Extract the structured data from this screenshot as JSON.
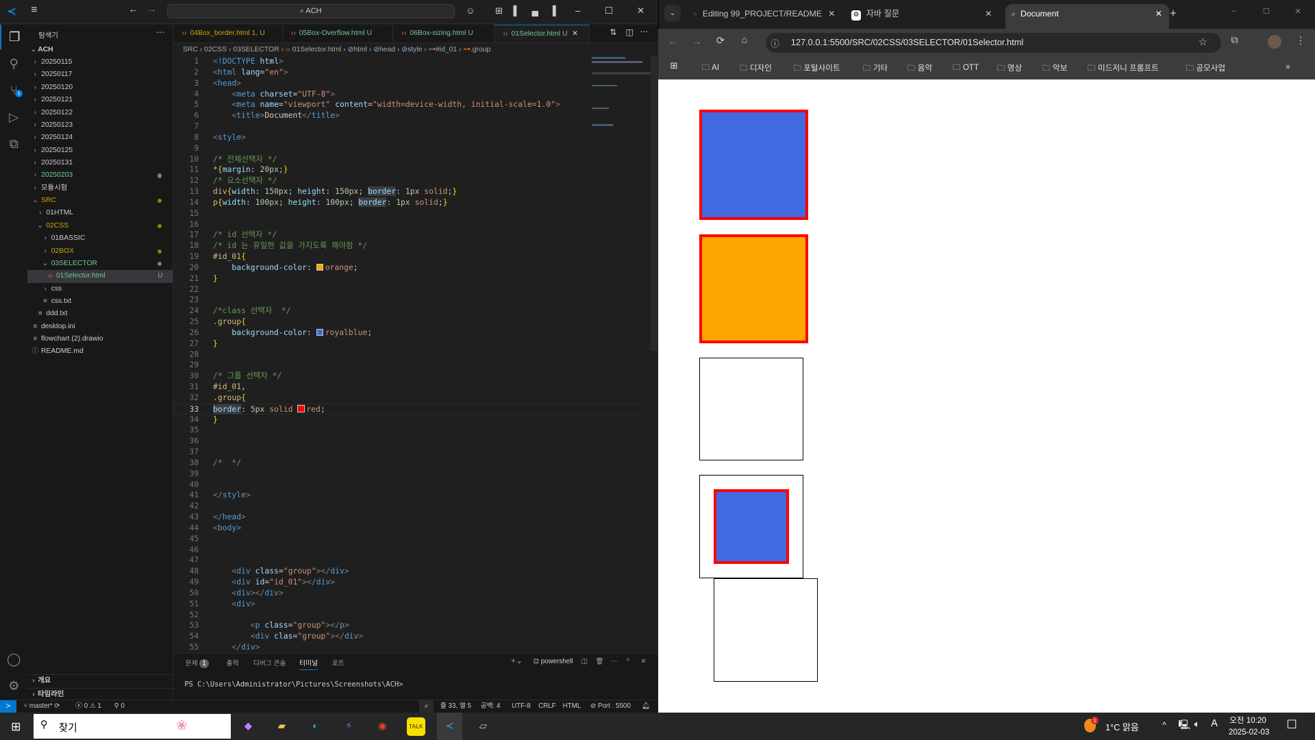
{
  "vscode": {
    "search": "ACH",
    "explorer_title": "탐색기",
    "root": "ACH",
    "tree": [
      {
        "label": "20250115",
        "depth": 0,
        "kind": "folder",
        "open": false,
        "color": "#cccccc"
      },
      {
        "label": "20250117",
        "depth": 0,
        "kind": "folder",
        "open": false,
        "color": "#cccccc"
      },
      {
        "label": "20250120",
        "depth": 0,
        "kind": "folder",
        "open": false,
        "color": "#cccccc"
      },
      {
        "label": "20250121",
        "depth": 0,
        "kind": "folder",
        "open": false,
        "color": "#cccccc"
      },
      {
        "label": "20250122",
        "depth": 0,
        "kind": "folder",
        "open": false,
        "color": "#cccccc"
      },
      {
        "label": "20250123",
        "depth": 0,
        "kind": "folder",
        "open": false,
        "color": "#cccccc"
      },
      {
        "label": "20250124",
        "depth": 0,
        "kind": "folder",
        "open": false,
        "color": "#cccccc"
      },
      {
        "label": "20250125",
        "depth": 0,
        "kind": "folder",
        "open": false,
        "color": "#cccccc"
      },
      {
        "label": "20250131",
        "depth": 0,
        "kind": "folder",
        "open": false,
        "color": "#cccccc"
      },
      {
        "label": "20250203",
        "depth": 0,
        "kind": "folder",
        "open": false,
        "color": "#73c991",
        "dot": true
      },
      {
        "label": "모듈시험",
        "depth": 0,
        "kind": "folder",
        "open": false,
        "color": "#cccccc"
      },
      {
        "label": "SRC",
        "depth": 0,
        "kind": "folder",
        "open": true,
        "color": "#cca700",
        "dot": true
      },
      {
        "label": "01HTML",
        "depth": 1,
        "kind": "folder",
        "open": false,
        "color": "#cccccc"
      },
      {
        "label": "02CSS",
        "depth": 1,
        "kind": "folder",
        "open": true,
        "color": "#cca700",
        "dot": true
      },
      {
        "label": "01BASSIC",
        "depth": 2,
        "kind": "folder",
        "open": false,
        "color": "#cccccc"
      },
      {
        "label": "02BOX",
        "depth": 2,
        "kind": "folder",
        "open": false,
        "color": "#cca700",
        "dot": true
      },
      {
        "label": "03SELECTOR",
        "depth": 2,
        "kind": "folder",
        "open": true,
        "color": "#73c991",
        "dot": true
      },
      {
        "label": "01Selector.html",
        "depth": 3,
        "kind": "html",
        "color": "#73c991",
        "badge": "U",
        "selected": true
      },
      {
        "label": "css",
        "depth": 2,
        "kind": "folder",
        "open": false,
        "color": "#cccccc"
      },
      {
        "label": "css.txt",
        "depth": 2,
        "kind": "file",
        "color": "#cccccc"
      },
      {
        "label": "ddd.txt",
        "depth": 1,
        "kind": "file",
        "color": "#cccccc"
      },
      {
        "label": "desktop.ini",
        "depth": 0,
        "kind": "file",
        "color": "#cccccc"
      },
      {
        "label": "flowchart (2).drawio",
        "depth": 0,
        "kind": "file",
        "color": "#cccccc"
      },
      {
        "label": "README.md",
        "depth": 0,
        "kind": "info",
        "color": "#cccccc"
      }
    ],
    "outline": "개요",
    "timeline": "타임라인",
    "tabs": [
      {
        "label": "04Box_border.html",
        "status": "1, U",
        "color": "#cca700"
      },
      {
        "label": "05Box-Overflow.html",
        "status": "U",
        "color": "#73c991"
      },
      {
        "label": "06Box-sizing.html",
        "status": "U",
        "color": "#73c991"
      },
      {
        "label": "01Selector.html",
        "status": "U",
        "color": "#73c991",
        "active": true
      }
    ],
    "breadcrumb": [
      "SRC",
      "02CSS",
      "03SELECTOR",
      "01Selector.html",
      "html",
      "head",
      "style",
      "#id_01",
      ".group"
    ],
    "code": [
      [
        [
          "<",
          "br"
        ],
        [
          "!DOCTYPE",
          "tag"
        ],
        [
          " html",
          "attr"
        ],
        [
          ">",
          "br"
        ]
      ],
      [
        [
          "<",
          "br"
        ],
        [
          "html",
          "tag"
        ],
        [
          " lang",
          "attr"
        ],
        [
          "=",
          "pun"
        ],
        [
          "\"en\"",
          "str"
        ],
        [
          ">",
          "br"
        ]
      ],
      [
        [
          "<",
          "br"
        ],
        [
          "head",
          "tag"
        ],
        [
          ">",
          "br"
        ]
      ],
      [
        [
          "    <",
          "br"
        ],
        [
          "meta",
          "tag"
        ],
        [
          " charset",
          "attr"
        ],
        [
          "=",
          "pun"
        ],
        [
          "\"UTF-8\"",
          "str"
        ],
        [
          ">",
          "br"
        ]
      ],
      [
        [
          "    <",
          "br"
        ],
        [
          "meta",
          "tag"
        ],
        [
          " name",
          "attr"
        ],
        [
          "=",
          "pun"
        ],
        [
          "\"viewport\"",
          "str"
        ],
        [
          " content",
          "attr"
        ],
        [
          "=",
          "pun"
        ],
        [
          "\"width=device-width, initial-scale=1.0\"",
          "str"
        ],
        [
          ">",
          "br"
        ]
      ],
      [
        [
          "    <",
          "br"
        ],
        [
          "title",
          "tag"
        ],
        [
          ">",
          "br"
        ],
        [
          "Document",
          "txt"
        ],
        [
          "</",
          "br"
        ],
        [
          "title",
          "tag"
        ],
        [
          ">",
          "br"
        ]
      ],
      [],
      [
        [
          "<",
          "br"
        ],
        [
          "style",
          "tag"
        ],
        [
          ">",
          "br"
        ]
      ],
      [],
      [
        [
          "/* 전체선택자 */",
          "com"
        ]
      ],
      [
        [
          "*",
          "sel"
        ],
        [
          "{",
          "brace"
        ],
        [
          "margin",
          "prop"
        ],
        [
          ": ",
          "pun"
        ],
        [
          "20px",
          "num"
        ],
        [
          ";",
          "pun"
        ],
        [
          "}",
          "brace"
        ]
      ],
      [
        [
          "/* 요소선택자 */",
          "com"
        ]
      ],
      [
        [
          "div",
          "sel"
        ],
        [
          "{",
          "brace"
        ],
        [
          "width",
          "prop"
        ],
        [
          ": ",
          "pun"
        ],
        [
          "150px",
          "num"
        ],
        [
          "; ",
          "pun"
        ],
        [
          "height",
          "prop"
        ],
        [
          ": ",
          "pun"
        ],
        [
          "150px",
          "num"
        ],
        [
          "; ",
          "pun"
        ],
        [
          "border",
          "hl"
        ],
        [
          ": ",
          "pun"
        ],
        [
          "1px",
          "num"
        ],
        [
          " solid",
          "val"
        ],
        [
          ";",
          "pun"
        ],
        [
          "}",
          "brace"
        ]
      ],
      [
        [
          "p",
          "sel"
        ],
        [
          "{",
          "brace"
        ],
        [
          "width",
          "prop"
        ],
        [
          ": ",
          "pun"
        ],
        [
          "100px",
          "num"
        ],
        [
          "; ",
          "pun"
        ],
        [
          "height",
          "prop"
        ],
        [
          ": ",
          "pun"
        ],
        [
          "100px",
          "num"
        ],
        [
          "; ",
          "pun"
        ],
        [
          "border",
          "hl"
        ],
        [
          ": ",
          "pun"
        ],
        [
          "1px",
          "num"
        ],
        [
          " solid",
          "val"
        ],
        [
          ";",
          "pun"
        ],
        [
          "}",
          "brace"
        ]
      ],
      [],
      [],
      [
        [
          "/* id 선택자 */",
          "com"
        ]
      ],
      [
        [
          "/* id 는 유일한 값을 가지도록 해야함 */",
          "com"
        ]
      ],
      [
        [
          "#id_01",
          "sel"
        ],
        [
          "{",
          "brace"
        ]
      ],
      [
        [
          "    background-color",
          "prop"
        ],
        [
          ": ",
          "pun"
        ],
        [
          "#orange",
          "swatch"
        ],
        [
          "orange",
          "val"
        ],
        [
          ";",
          "pun"
        ]
      ],
      [
        [
          "}",
          "brace"
        ]
      ],
      [],
      [],
      [
        [
          "/*class 선택자  */",
          "com"
        ]
      ],
      [
        [
          ".group",
          "sel"
        ],
        [
          "{",
          "brace"
        ]
      ],
      [
        [
          "    background-color",
          "prop"
        ],
        [
          ": ",
          "pun"
        ],
        [
          "#royalblue",
          "swatch"
        ],
        [
          "royalblue",
          "val"
        ],
        [
          ";",
          "pun"
        ]
      ],
      [
        [
          "}",
          "brace"
        ]
      ],
      [],
      [],
      [
        [
          "/* 그룹 선택자 */",
          "com"
        ]
      ],
      [
        [
          "#id_01",
          "sel"
        ],
        [
          ",",
          "pun"
        ]
      ],
      [
        [
          ".group",
          "sel"
        ],
        [
          "{",
          "brace"
        ]
      ],
      [
        [
          "border",
          "hl"
        ],
        [
          ": ",
          "pun"
        ],
        [
          "5px",
          "num"
        ],
        [
          " solid ",
          "val"
        ],
        [
          "#red",
          "swatch"
        ],
        [
          "red",
          "val"
        ],
        [
          ";",
          "pun"
        ]
      ],
      [
        [
          "}",
          "brace"
        ]
      ],
      [],
      [],
      [],
      [
        [
          "/*  */",
          "com"
        ]
      ],
      [],
      [],
      [
        [
          "</",
          "br"
        ],
        [
          "style",
          "tag"
        ],
        [
          ">",
          "br"
        ]
      ],
      [],
      [
        [
          "</",
          "br"
        ],
        [
          "head",
          "tag"
        ],
        [
          ">",
          "br"
        ]
      ],
      [
        [
          "<",
          "br"
        ],
        [
          "body",
          "tag"
        ],
        [
          ">",
          "br"
        ]
      ],
      [],
      [],
      [],
      [
        [
          "    <",
          "br"
        ],
        [
          "div",
          "tag"
        ],
        [
          " class",
          "attr"
        ],
        [
          "=",
          "pun"
        ],
        [
          "\"group\"",
          "str"
        ],
        [
          "></",
          "br"
        ],
        [
          "div",
          "tag"
        ],
        [
          ">",
          "br"
        ]
      ],
      [
        [
          "    <",
          "br"
        ],
        [
          "div",
          "tag"
        ],
        [
          " id",
          "attr"
        ],
        [
          "=",
          "pun"
        ],
        [
          "\"id_01\"",
          "str"
        ],
        [
          "></",
          "br"
        ],
        [
          "div",
          "tag"
        ],
        [
          ">",
          "br"
        ]
      ],
      [
        [
          "    <",
          "br"
        ],
        [
          "div",
          "tag"
        ],
        [
          "></",
          "br"
        ],
        [
          "div",
          "tag"
        ],
        [
          ">",
          "br"
        ]
      ],
      [
        [
          "    <",
          "br"
        ],
        [
          "div",
          "tag"
        ],
        [
          ">",
          "br"
        ]
      ],
      [],
      [
        [
          "        <",
          "br"
        ],
        [
          "p",
          "tag"
        ],
        [
          " class",
          "attr"
        ],
        [
          "=",
          "pun"
        ],
        [
          "\"group\"",
          "str"
        ],
        [
          "></",
          "br"
        ],
        [
          "p",
          "tag"
        ],
        [
          ">",
          "br"
        ]
      ],
      [
        [
          "        <",
          "br"
        ],
        [
          "div",
          "tag"
        ],
        [
          " clas",
          "attr"
        ],
        [
          "=",
          "pun"
        ],
        [
          "\"group\"",
          "str"
        ],
        [
          "></",
          "br"
        ],
        [
          "div",
          "tag"
        ],
        [
          ">",
          "br"
        ]
      ],
      [
        [
          "    </",
          "br"
        ],
        [
          "div",
          "tag"
        ],
        [
          ">",
          "br"
        ]
      ]
    ],
    "current_line": 33,
    "panel": {
      "tabs": [
        "문제",
        "출력",
        "디버그 콘솔",
        "터미널",
        "포트"
      ],
      "problems_count": "1",
      "active_tab": 3,
      "shell": "powershell",
      "terminal_text": "PS C:\\Users\\Administrator\\Pictures\\Screenshots\\ACH>"
    },
    "status": {
      "branch": "master*",
      "errors": "0",
      "warnings": "1",
      "ports": "0",
      "position": "줄 33, 열 5",
      "spaces": "공백: 4",
      "encoding": "UTF-8",
      "eol": "CRLF",
      "language": "HTML",
      "port": "Port : 5500"
    }
  },
  "browser": {
    "tabs": [
      {
        "label": "Editing 99_PROJECT/README"
      },
      {
        "label": "자바 질문"
      },
      {
        "label": "Document",
        "active": true
      }
    ],
    "url": "127.0.0.1:5500/SRC/02CSS/03SELECTOR/01Selector.html",
    "bookmarks": [
      "AI",
      "디자인",
      "포털사이트",
      "기타",
      "음악",
      "OTT",
      "영상",
      "악보",
      "미드저니 프롬프트",
      "공모사업"
    ],
    "colors": {
      "royalblue": "#4169e1",
      "orange": "#ffa500",
      "red": "#ff0000"
    }
  },
  "taskbar": {
    "search": "찾기",
    "weather": "1°C 맑음",
    "weather_badge": "1",
    "ime": "A",
    "time": "오전 10:20",
    "date": "2025-02-03"
  }
}
